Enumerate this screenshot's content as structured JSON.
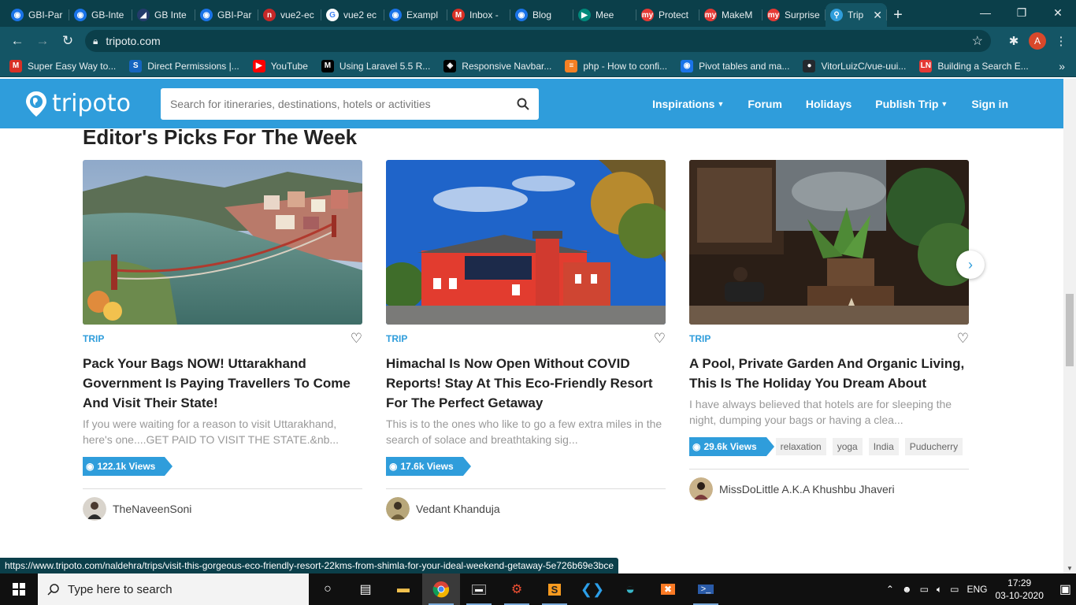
{
  "browser": {
    "tabs": [
      {
        "label": "GBI-Par",
        "color": "#1a73e8",
        "glyph": "◉"
      },
      {
        "label": "GB-Inte",
        "color": "#1a73e8",
        "glyph": "◉"
      },
      {
        "label": "GB Inte",
        "color": "#243b6b",
        "glyph": "◢"
      },
      {
        "label": "GBI-Par",
        "color": "#1a73e8",
        "glyph": "◉"
      },
      {
        "label": "vue2-ec",
        "color": "#c62828",
        "glyph": "n"
      },
      {
        "label": "vue2 ec",
        "color": "#ffffff",
        "glyph": "G"
      },
      {
        "label": "Exampl",
        "color": "#1a73e8",
        "glyph": "◉"
      },
      {
        "label": "Inbox -",
        "color": "#d93025",
        "glyph": "M"
      },
      {
        "label": "Blog",
        "color": "#1a73e8",
        "glyph": "◉"
      },
      {
        "label": "Mee",
        "color": "#00897b",
        "glyph": "▶"
      },
      {
        "label": "Protect",
        "color": "#e53935",
        "glyph": "my"
      },
      {
        "label": "MakeM",
        "color": "#e53935",
        "glyph": "my"
      },
      {
        "label": "Surprise",
        "color": "#e53935",
        "glyph": "my"
      },
      {
        "label": "Trip",
        "color": "#2f9ddb",
        "glyph": "⚲"
      }
    ],
    "url": "tripoto.com",
    "profile_initial": "A",
    "bookmarks": [
      {
        "label": "Super Easy Way to...",
        "color": "#d93025",
        "glyph": "M"
      },
      {
        "label": "Direct Permissions |...",
        "color": "#1565c0",
        "glyph": "S"
      },
      {
        "label": "YouTube",
        "color": "#ff0000",
        "glyph": "▶"
      },
      {
        "label": "Using Laravel 5.5 R...",
        "color": "#000000",
        "glyph": "M"
      },
      {
        "label": "Responsive Navbar...",
        "color": "#000000",
        "glyph": "◈"
      },
      {
        "label": "php - How to confi...",
        "color": "#f48024",
        "glyph": "≡"
      },
      {
        "label": "Pivot tables and ma...",
        "color": "#1a73e8",
        "glyph": "◉"
      },
      {
        "label": "VitorLuizC/vue-uui...",
        "color": "#24292e",
        "glyph": "●"
      },
      {
        "label": "Building a Search E...",
        "color": "#e53935",
        "glyph": "LN"
      }
    ],
    "status_url": "https://www.tripoto.com/naldehra/trips/visit-this-gorgeous-eco-friendly-resort-22kms-from-shimla-for-your-ideal-weekend-getaway-5e726b69e3bce"
  },
  "site": {
    "logo": "tripoto",
    "search_placeholder": "Search for itineraries, destinations, hotels or activities",
    "nav": [
      "Inspirations",
      "Forum",
      "Holidays",
      "Publish Trip",
      "Sign in"
    ],
    "brand_color": "#2f9ddb"
  },
  "section": {
    "title": "Editor's Picks For The Week"
  },
  "cards": [
    {
      "tag": "TRIP",
      "title": "Pack Your Bags NOW! Uttarakhand Government Is Paying Travellers To Come And Visit Their State!",
      "excerpt": "If you were waiting for a reason to visit Uttarakhand, here's one....GET PAID TO VISIT THE STATE.&nb...",
      "views": "122.1k Views",
      "chips": [],
      "author": "TheNaveenSoni"
    },
    {
      "tag": "TRIP",
      "title": "Himachal Is Now Open Without COVID Reports! Stay At This Eco-Friendly Resort For The Perfect Getaway",
      "excerpt": "This is to the ones who like to go a few extra miles in the search of solace and breathtaking sig...",
      "views": "17.6k Views",
      "chips": [],
      "author": "Vedant Khanduja"
    },
    {
      "tag": "TRIP",
      "title": "A Pool, Private Garden And Organic Living, This Is The Holiday You Dream About",
      "excerpt": "I have always believed that hotels are for sleeping the night, dumping your bags or having a clea...",
      "views": "29.6k Views",
      "chips": [
        "relaxation",
        "yoga",
        "India",
        "Puducherry"
      ],
      "author": "MissDoLittle A.K.A Khushbu Jhaveri"
    }
  ],
  "taskbar": {
    "search_placeholder": "Type here to search",
    "language": "ENG",
    "time": "17:29",
    "date": "03-10-2020"
  }
}
